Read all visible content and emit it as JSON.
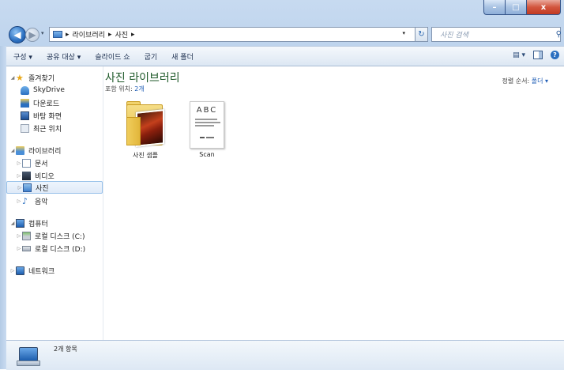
{
  "window": {
    "min_label": "–",
    "max_label": "□",
    "close_label": "x"
  },
  "nav": {
    "back_label": "◀",
    "forward_label": "▶"
  },
  "address": {
    "segments": [
      "라이브러리",
      "사진"
    ],
    "sep": "▸"
  },
  "search": {
    "placeholder": "사진 검색"
  },
  "toolbar": {
    "items": [
      "구성 ▾",
      "공유 대상 ▾",
      "슬라이드 쇼",
      "굽기",
      "새 폴더"
    ]
  },
  "sidebar": {
    "favorites_label": "즐겨찾기",
    "favorites": [
      "SkyDrive",
      "다운로드",
      "바탕 화면",
      "최근 위치"
    ],
    "libraries_label": "라이브러리",
    "libraries": [
      "문서",
      "비디오",
      "사진",
      "음악"
    ],
    "computer_label": "컴퓨터",
    "drives": [
      "로컬 디스크 (C:)",
      "로컬 디스크 (D:)"
    ],
    "network_label": "네트워크"
  },
  "library": {
    "title": "사진 라이브러리",
    "includes_prefix": "포함 위치: ",
    "includes_link": "2개",
    "sort_prefix": "정렬 순서: ",
    "sort_value": "폴더 ▾"
  },
  "items": [
    {
      "name": "사진 샘플"
    },
    {
      "name": "Scan"
    }
  ],
  "scan_thumb_text": "ABC",
  "status": {
    "text": "2개 항목"
  }
}
